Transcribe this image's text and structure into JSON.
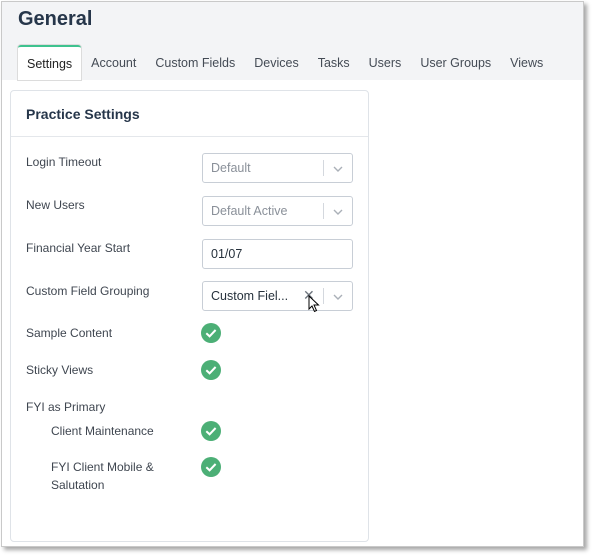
{
  "page": {
    "title": "General"
  },
  "tabs": [
    {
      "label": "Settings",
      "active": true
    },
    {
      "label": "Account"
    },
    {
      "label": "Custom Fields"
    },
    {
      "label": "Devices"
    },
    {
      "label": "Tasks"
    },
    {
      "label": "Users"
    },
    {
      "label": "User Groups"
    },
    {
      "label": "Views"
    }
  ],
  "practice_settings": {
    "title": "Practice Settings",
    "login_timeout": {
      "label": "Login Timeout",
      "value": "Default"
    },
    "new_users": {
      "label": "New Users",
      "value": "Default Active"
    },
    "financial_year_start": {
      "label": "Financial Year Start",
      "value": "01/07"
    },
    "custom_field_grouping": {
      "label": "Custom Field Grouping",
      "value": "Custom Fiel..."
    },
    "sample_content": {
      "label": "Sample Content",
      "checked": true
    },
    "sticky_views": {
      "label": "Sticky Views",
      "checked": true
    },
    "fyi_as_primary": {
      "label": "FYI as Primary",
      "client_maintenance": {
        "label": "Client Maintenance",
        "checked": true
      },
      "client_mobile": {
        "label": "FYI Client Mobile & Salutation",
        "checked": true
      }
    }
  },
  "colors": {
    "accent": "#3ec28f",
    "check_fill": "#4caf76",
    "title_text": "#26364a",
    "header_bg": "#f3f4f6"
  },
  "icons": {
    "dropdown": "chevron-down-icon",
    "clear": "clear-icon",
    "check": "check-circle-icon",
    "cursor": "mouse-pointer-icon"
  }
}
